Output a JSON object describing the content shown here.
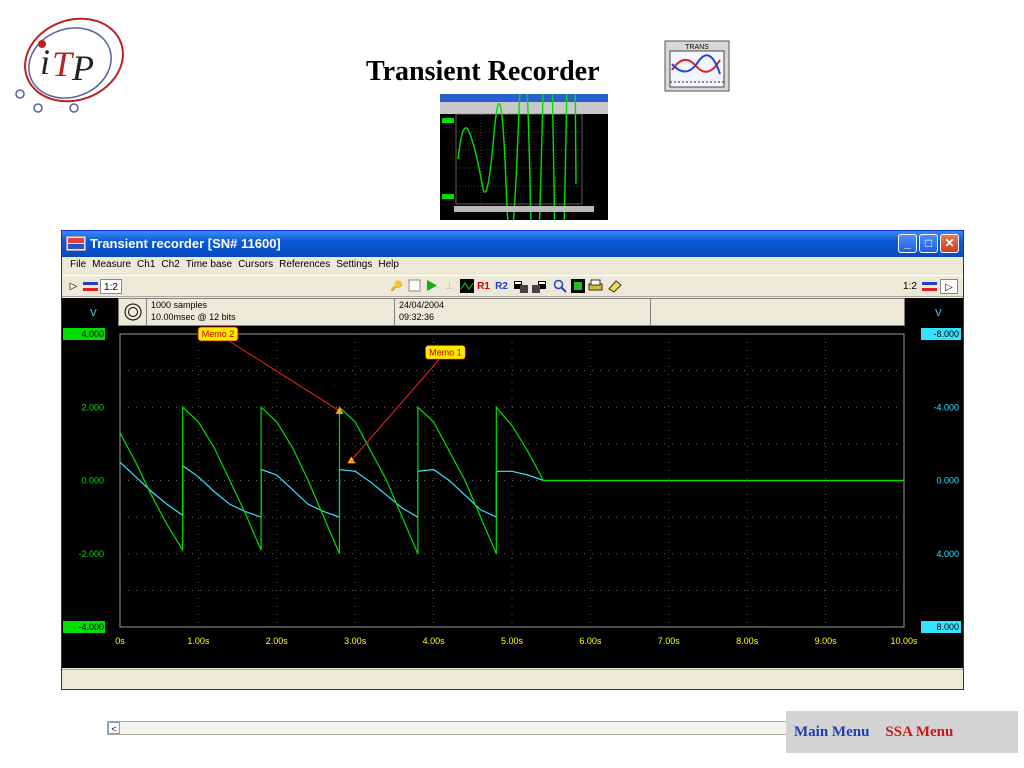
{
  "slide": {
    "title": "Transient Recorder",
    "logo_text": "iTP",
    "icon_label": "TRANS",
    "footer": {
      "main_menu": "Main Menu",
      "ssa_menu": "SSA Menu"
    }
  },
  "window": {
    "title": "Transient recorder  [SN# 11600]",
    "menu": [
      "File",
      "Measure",
      "Ch1",
      "Ch2",
      "Time base",
      "Cursors",
      "References",
      "Settings",
      "Help"
    ],
    "toolbar": {
      "left_label": "1:2",
      "right_label": "1:2",
      "r1": "R1",
      "r2": "R2"
    },
    "info": {
      "samples": "1000 samples",
      "rate": "10.00msec @ 12 bits",
      "date": "24/04/2004",
      "time": "09:32:36"
    },
    "units": {
      "left": "V",
      "right": "V"
    }
  },
  "colors": {
    "ch1": "#36e3ff",
    "ch2": "#00e000",
    "memo_bg": "#ffe800",
    "memo_arrow": "#ff2020",
    "tick_label": "#ffff00"
  },
  "chart_data": {
    "type": "line",
    "x_ticks": [
      "0s",
      "1.00s",
      "2.00s",
      "3.00s",
      "4.00s",
      "5.00s",
      "6.00s",
      "7.00s",
      "8.00s",
      "9.00s",
      "10.00s"
    ],
    "xlim": [
      0,
      10
    ],
    "y_ticks_right": [
      "-8.000",
      "-4.000",
      "0.000",
      "4.000",
      "8.000"
    ],
    "ylim_right": [
      -8,
      8
    ],
    "y_ticks_left": [
      "4.000",
      "2.000",
      "0.000",
      "-2.000",
      "-4.000"
    ],
    "ylim_left": [
      -4,
      4
    ],
    "series": [
      {
        "channel": "ch1",
        "axis": "right",
        "x": [
          0,
          0.2,
          0.4,
          0.6,
          0.8,
          0.8,
          1.0,
          1.2,
          1.4,
          1.6,
          1.8,
          1.8,
          2.0,
          2.2,
          2.4,
          2.6,
          2.8,
          2.8,
          3.0,
          3.2,
          3.4,
          3.6,
          3.8,
          3.8,
          4.0,
          4.2,
          4.4,
          4.6,
          4.8,
          4.8,
          5.0,
          5.2,
          5.4,
          5.4,
          6.0,
          7.0,
          8.0,
          9.0,
          10.0
        ],
        "y": [
          -1.0,
          -0.2,
          0.6,
          1.3,
          1.9,
          -0.8,
          -0.2,
          0.6,
          1.3,
          1.7,
          2.0,
          -0.6,
          -0.3,
          0.5,
          1.3,
          1.7,
          2.0,
          -0.6,
          -0.5,
          0.1,
          0.8,
          1.5,
          2.0,
          -0.5,
          -0.6,
          0.0,
          0.8,
          1.6,
          2.0,
          -0.5,
          -0.5,
          -0.3,
          0.0,
          0.0,
          0.0,
          0.0,
          0.0,
          0.0,
          0.0
        ]
      },
      {
        "channel": "ch2",
        "axis": "left",
        "x": [
          0,
          0.2,
          0.4,
          0.6,
          0.8,
          0.8,
          1.0,
          1.2,
          1.4,
          1.6,
          1.8,
          1.8,
          2.0,
          2.2,
          2.4,
          2.6,
          2.8,
          2.8,
          3.0,
          3.2,
          3.4,
          3.6,
          3.8,
          3.8,
          4.0,
          4.2,
          4.4,
          4.6,
          4.8,
          4.8,
          5.0,
          5.2,
          5.4,
          5.4,
          6.0,
          7.0,
          8.0,
          9.0,
          10.0
        ],
        "y": [
          1.3,
          0.5,
          -0.4,
          -1.2,
          -1.9,
          2.0,
          1.6,
          0.9,
          0.0,
          -0.9,
          -1.9,
          2.0,
          1.6,
          0.9,
          0.0,
          -1.0,
          -2.0,
          2.0,
          1.6,
          0.8,
          0.0,
          -1.0,
          -2.0,
          2.0,
          1.6,
          0.8,
          0.0,
          -1.0,
          -2.0,
          2.0,
          1.5,
          0.8,
          0.0,
          0.0,
          0.0,
          0.0,
          0.0,
          0.0,
          0.0
        ]
      }
    ],
    "annotations": [
      {
        "text": "Memo 1",
        "label_x": 4.15,
        "label_y_right": -7.0,
        "point_x": 2.95,
        "point_y_right": -1.1
      },
      {
        "text": "Memo 2",
        "label_x": 1.25,
        "label_y_left": 4.0,
        "point_x": 2.8,
        "point_y_left": 1.9
      }
    ]
  }
}
